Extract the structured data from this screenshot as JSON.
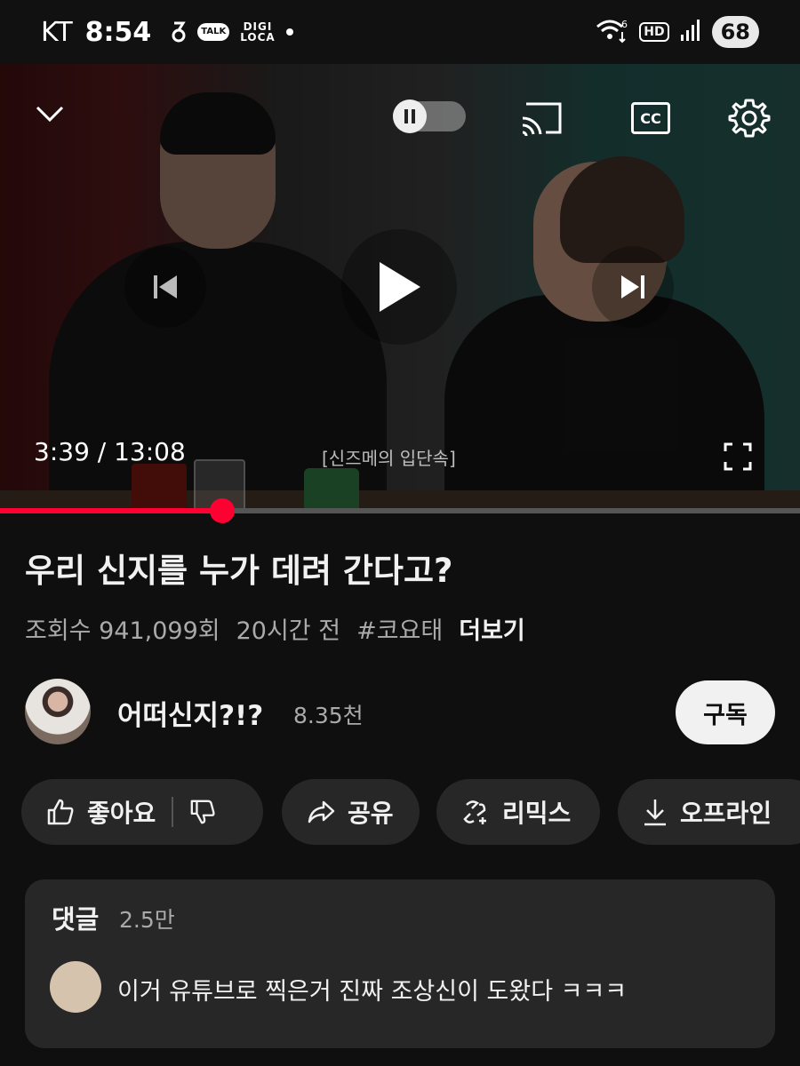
{
  "status_bar": {
    "carrier": "KT",
    "time": "8:54",
    "talk_label": "TALK",
    "digi_label": "DIGI LOCA",
    "hd_label": "HD",
    "battery": "68",
    "icons": [
      "kakao-icon",
      "talk-icon",
      "digiloca-icon",
      "wifi-icon",
      "hd-icon",
      "signal-icon",
      "battery-icon"
    ]
  },
  "player": {
    "time": "3:39 / 13:08",
    "caption": "[신즈메의 입단속]",
    "progress": 0.278,
    "cc_label": "CC",
    "colors": {
      "progress": "#ff0033",
      "track": "#555555"
    }
  },
  "video": {
    "title": "우리 신지를 누가 데려 간다고?",
    "views": "조회수 941,099회",
    "age": "20시간 전",
    "hashtag": "#코요태",
    "more": "더보기"
  },
  "channel": {
    "name": "어떠신지?!?",
    "subscribers": "8.35천",
    "subscribe_label": "구독"
  },
  "actions": {
    "like": "좋아요",
    "share": "공유",
    "remix": "리믹스",
    "offline": "오프라인"
  },
  "comments": {
    "title": "댓글",
    "count": "2.5만",
    "top_comment": "이거 유튜브로 찍은거 진짜 조상신이 도왔다 ㅋㅋㅋ"
  }
}
